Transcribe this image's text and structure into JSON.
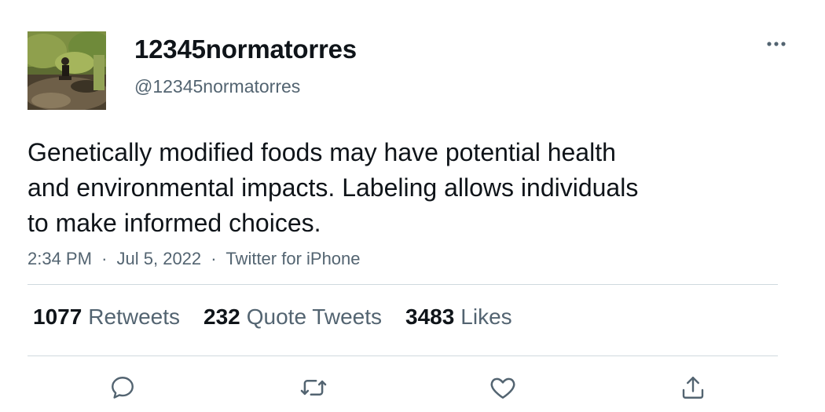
{
  "tweet": {
    "author": {
      "display_name": "12345normatorres",
      "handle": "@12345normatorres"
    },
    "text_lines": [
      "Genetically modified foods may have potential health",
      "and environmental impacts. Labeling allows individuals",
      "to make informed choices."
    ],
    "time": "2:34 PM",
    "date": "Jul 5, 2022",
    "source": "Twitter for iPhone",
    "separator": "·",
    "stats": {
      "retweets": {
        "count": "1077",
        "label": "Retweets"
      },
      "quote_tweets": {
        "count": "232",
        "label": "Quote Tweets"
      },
      "likes": {
        "count": "3483",
        "label": "Likes"
      }
    },
    "icons": {
      "more": "more-horizontal-icon",
      "reply": "reply-icon",
      "retweet": "retweet-icon",
      "like": "heart-icon",
      "share": "share-icon"
    },
    "colors": {
      "text_primary": "#0f1419",
      "text_secondary": "#536471",
      "divider": "#cfd9de"
    }
  }
}
